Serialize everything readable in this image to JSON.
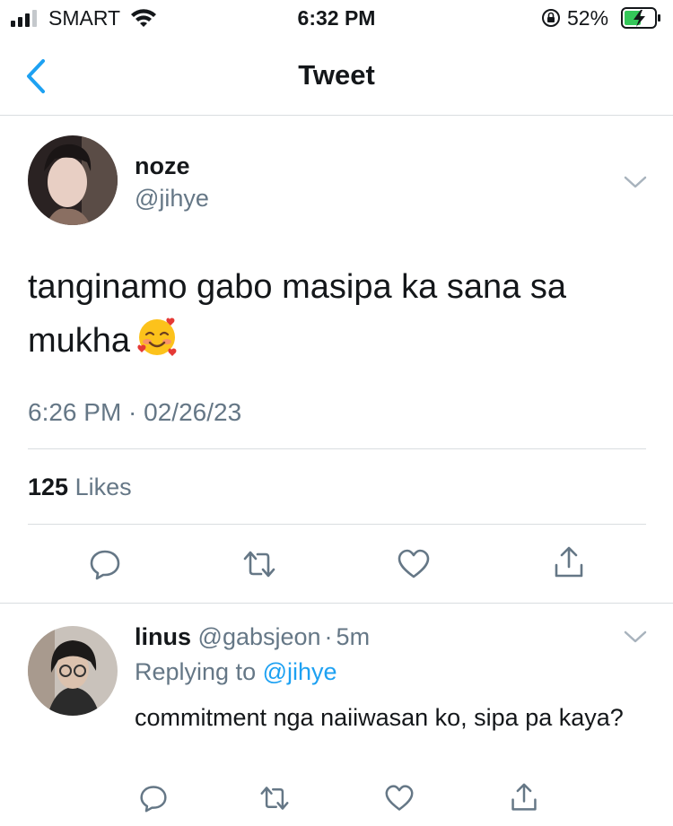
{
  "status_bar": {
    "carrier": "SMART",
    "time": "6:32 PM",
    "battery_percent": "52%",
    "icons": [
      "signal-icon",
      "wifi-icon",
      "rotation-lock-icon",
      "battery-charging-icon"
    ]
  },
  "nav": {
    "title": "Tweet",
    "back_icon": "chevron-left-icon"
  },
  "tweet": {
    "display_name": "noze",
    "handle": "@jihye",
    "text": "tanginamo gabo masipa ka sana sa mukha",
    "emoji": "smiling-face-with-hearts",
    "timestamp": "6:26 PM · 02/26/23",
    "likes_count": "125",
    "likes_label": "Likes"
  },
  "actions": [
    "reply-icon",
    "retweet-icon",
    "like-icon",
    "share-icon"
  ],
  "reply": {
    "display_name": "linus",
    "handle": "@gabsjeon",
    "sep": "·",
    "age": "5m",
    "replying_prefix": "Replying to",
    "replying_to": "@jihye",
    "text": "commitment nga naiiwasan ko, sipa pa kaya?"
  },
  "colors": {
    "accent": "#1da1f2",
    "secondary_text": "#657786",
    "divider": "#d9dde0"
  }
}
